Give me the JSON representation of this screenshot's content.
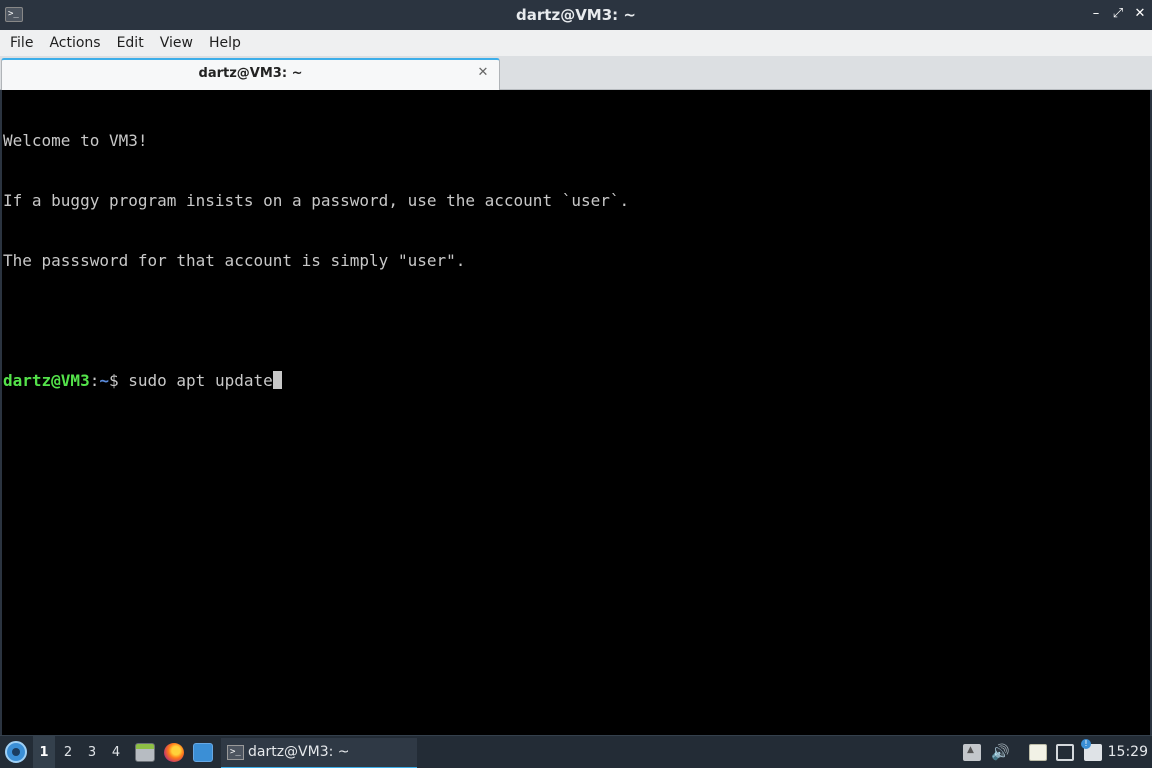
{
  "window": {
    "title": "dartz@VM3: ~",
    "icon_glyph": ">_",
    "minimize_glyph": "–",
    "maximize_glyph": "⤢",
    "close_glyph": "✕"
  },
  "menubar": {
    "items": [
      "File",
      "Actions",
      "Edit",
      "View",
      "Help"
    ]
  },
  "tabs": [
    {
      "label": "dartz@VM3: ~",
      "close_glyph": "✕"
    }
  ],
  "terminal": {
    "lines": [
      "Welcome to VM3!",
      "If a buggy program insists on a password, use the account `user`.",
      "The passsword for that account is simply \"user\".",
      ""
    ],
    "prompt": {
      "user_host": "dartz@VM3",
      "separator": ":",
      "path": "~",
      "symbol": "$ ",
      "command": "sudo apt update"
    },
    "colors": {
      "background": "#000000",
      "text": "#c8c8c8",
      "user_host": "#54e24a",
      "path": "#5a8bdc"
    }
  },
  "taskbar": {
    "desktops": [
      "1",
      "2",
      "3",
      "4"
    ],
    "active_desktop": "1",
    "launchers": [
      "file-manager-icon",
      "firefox-icon",
      "show-desktop-icon"
    ],
    "task": {
      "label": "dartz@VM3: ~",
      "icon_glyph": ">_"
    },
    "tray": [
      "tray-expand-icon",
      "volume-icon",
      "clipboard-icon",
      "network-icon",
      "update-notifier-icon"
    ],
    "volume_glyph": "🔊",
    "clock": "15:29"
  }
}
